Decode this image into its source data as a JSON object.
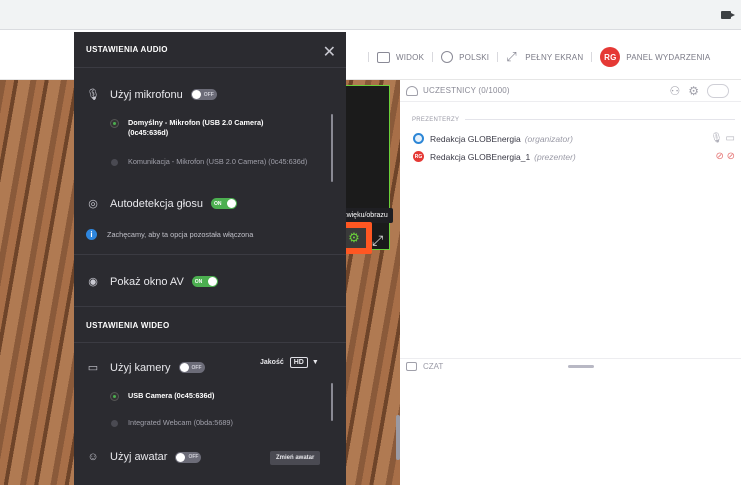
{
  "header": {
    "nav": [
      {
        "label": "WIDOK",
        "icon": "layout-icon"
      },
      {
        "label": "POLSKI",
        "icon": "globe-icon"
      },
      {
        "label": "PEŁNY EKRAN",
        "icon": "fullscreen-icon"
      }
    ],
    "avatar_initials": "RG",
    "panel_label": "PANEL WYDARZENIA"
  },
  "audio_panel": {
    "title": "USTAWIENIA AUDIO",
    "use_mic": {
      "label": "Użyj mikrofonu",
      "state": "OFF"
    },
    "mic_options": [
      {
        "label": "Domyślny - Mikrofon (USB 2.0 Camera) (0c45:636d)",
        "active": true
      },
      {
        "label": "Komunikacja - Mikrofon (USB 2.0 Camera) (0c45:636d)",
        "active": false
      }
    ],
    "autodetect": {
      "label": "Autodetekcja głosu",
      "state": "ON"
    },
    "info_text": "Zachęcamy, aby ta opcja pozostała włączona",
    "show_av": {
      "label": "Pokaż okno AV",
      "state": "ON"
    }
  },
  "video_panel": {
    "title": "USTAWIENIA WIDEO",
    "use_camera": {
      "label": "Użyj kamery",
      "state": "OFF"
    },
    "quality_label": "Jakość",
    "quality_value": "HD",
    "camera_options": [
      {
        "label": "USB Camera (0c45:636d)",
        "active": true
      },
      {
        "label": "Integrated Webcam (0bda:5689)",
        "active": false
      }
    ],
    "use_avatar": {
      "label": "Użyj awatar",
      "state": "OFF"
    },
    "change_avatar": "Zmień awatar"
  },
  "tooltip": "Ustawienia dźwięku/obrazu",
  "participants": {
    "title": "UCZESTNICY (0/1000)",
    "section": "PREZENTERZY",
    "people": [
      {
        "name": "Redakcja GLOBEnergia",
        "role": "(organizator)"
      },
      {
        "name": "Redakcja GLOBEnergia_1",
        "role": "(prezenter)"
      }
    ],
    "avatar_initials": "RG"
  },
  "chat": {
    "title": "CZAT"
  }
}
